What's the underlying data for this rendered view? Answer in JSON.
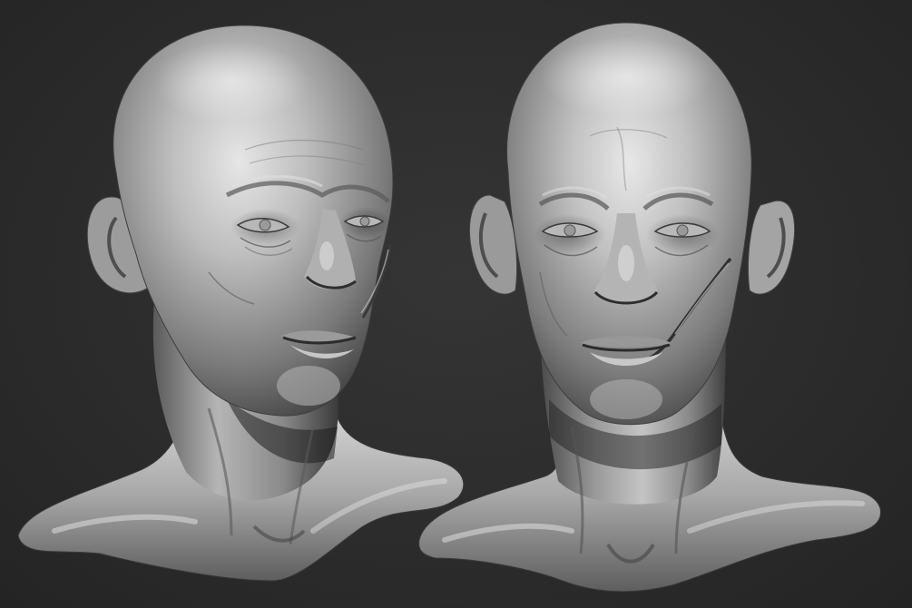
{
  "scene": {
    "background_color": "#2b2b2b",
    "material_color": "#9a9a9a",
    "subjects": [
      {
        "name": "sculpt-bust-three-quarter-view",
        "view": "three-quarter"
      },
      {
        "name": "sculpt-bust-front-view",
        "view": "front"
      }
    ]
  }
}
